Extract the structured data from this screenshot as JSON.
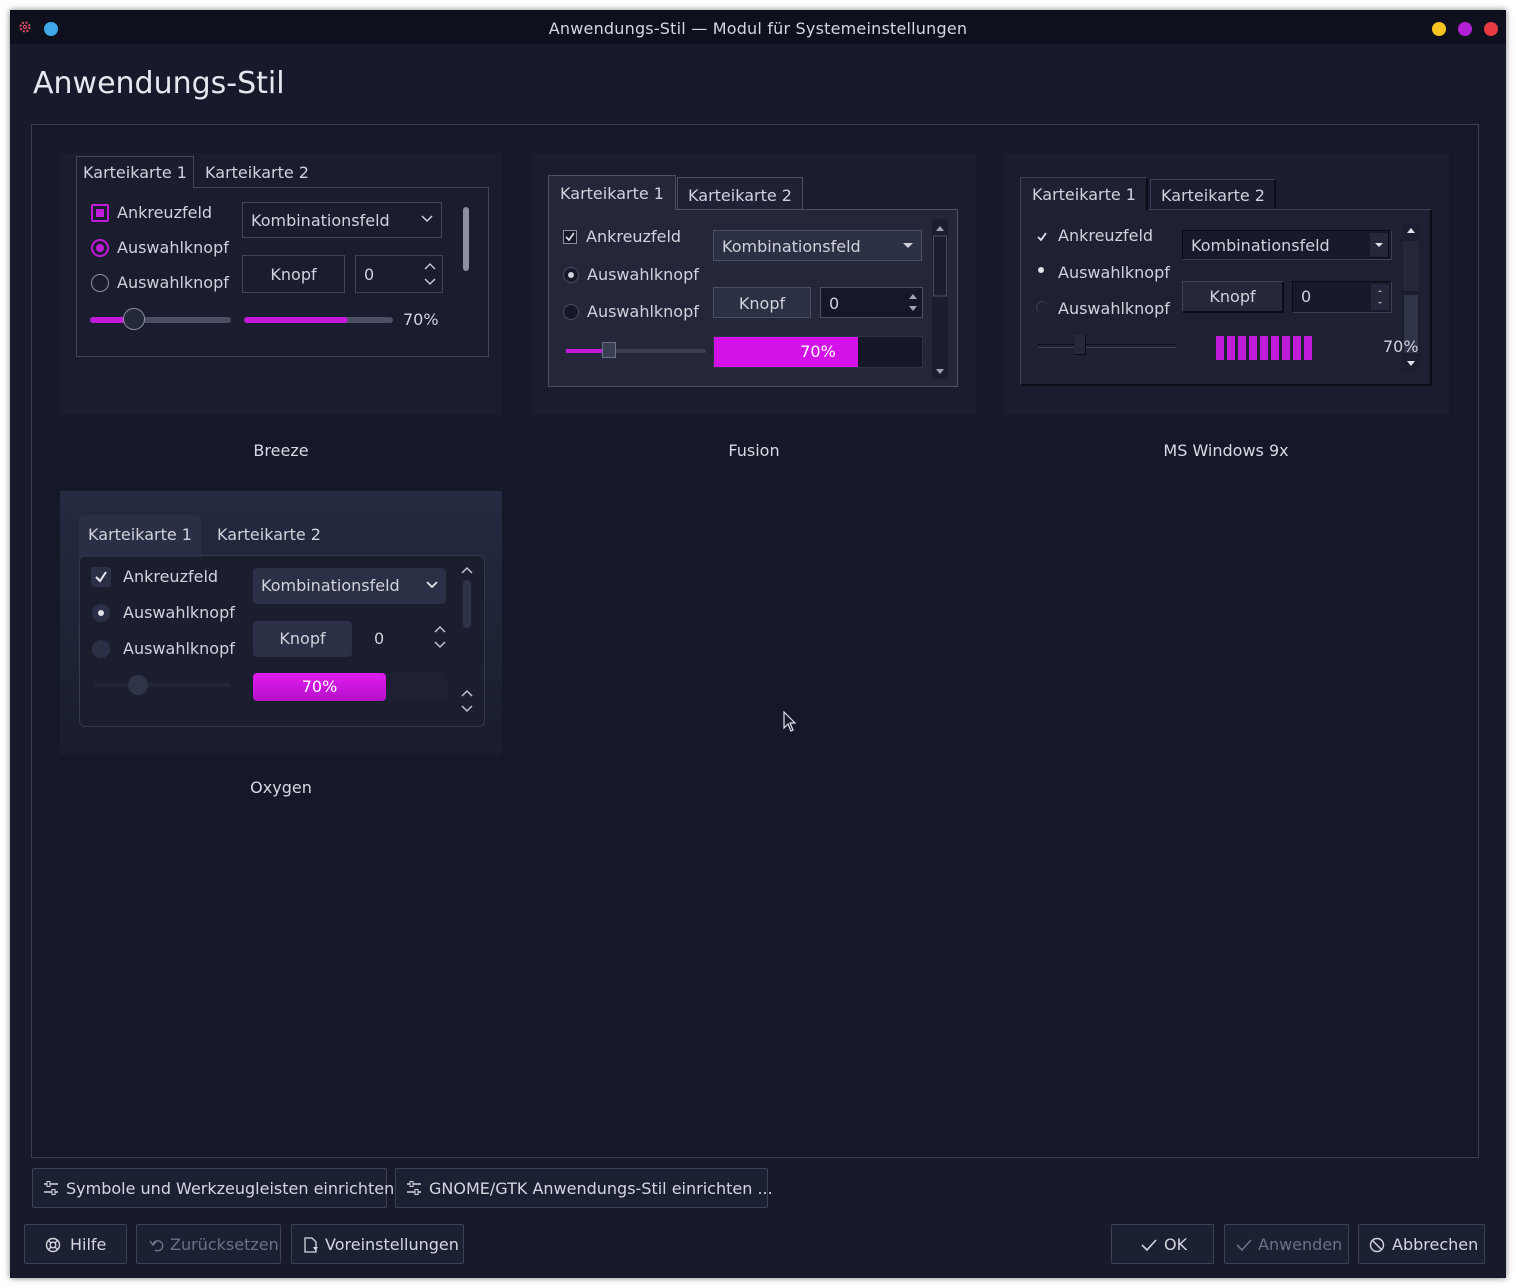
{
  "window": {
    "title": "Anwendungs-Stil — Modul für Systemeinstellungen",
    "page_title": "Anwendungs-Stil",
    "controls": [
      "minimize",
      "maximize",
      "close"
    ]
  },
  "preview": {
    "tab1": "Karteikarte 1",
    "tab2": "Karteikarte 2",
    "checkbox": "Ankreuzfeld",
    "radio1": "Auswahlknopf",
    "radio2": "Auswahlknopf",
    "combo": "Kombinationsfeld",
    "button": "Knopf",
    "spin_value": "0",
    "progress_label": "70%",
    "progress": 0.7,
    "slider": 0.3
  },
  "styles": [
    {
      "name": "Breeze"
    },
    {
      "name": "Fusion"
    },
    {
      "name": "MS Windows 9x"
    },
    {
      "name": "Oxygen"
    }
  ],
  "config_buttons": {
    "icons": "Symbole und Werkzeugleisten einrichten",
    "gtk": "GNOME/GTK Anwendungs-Stil einrichten ..."
  },
  "footer": {
    "help": "Hilfe",
    "reset": "Zurücksetzen",
    "defaults": "Voreinstellungen",
    "ok": "OK",
    "apply": "Anwenden",
    "cancel": "Abbrechen"
  },
  "colors": {
    "accent": "#c11ad8",
    "background": "#161a2b",
    "titlebar": "#0e111d",
    "minimize": "#f7c51e",
    "maximize": "#b31fd6",
    "close": "#e83a45"
  }
}
